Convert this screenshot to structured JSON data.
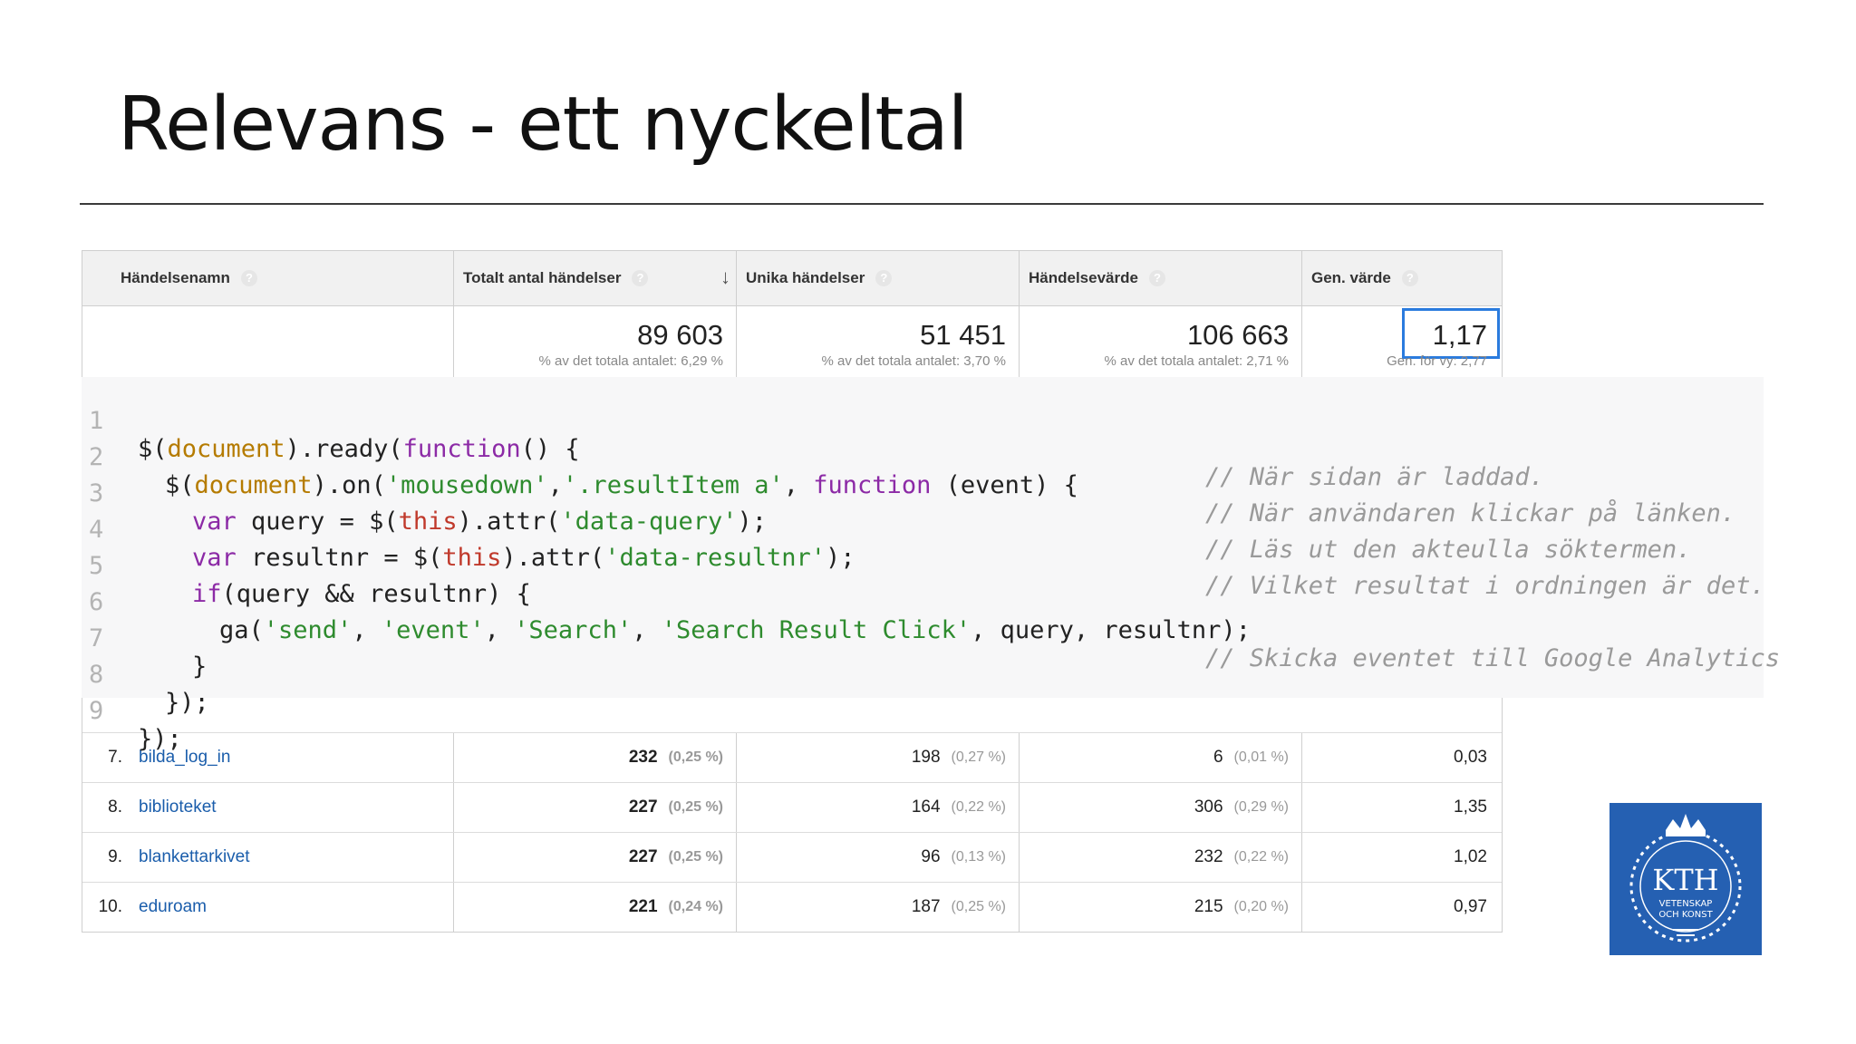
{
  "slide": {
    "title": "Relevans - ett nyckeltal"
  },
  "table": {
    "headers": [
      "Händelsenamn",
      "Totalt antal händelser",
      "Unika händelser",
      "Händelsevärde",
      "Gen. värde"
    ],
    "summary": [
      {
        "value": "89 603",
        "sub": "% av det totala antalet: 6,29 %"
      },
      {
        "value": "51 451",
        "sub": "% av det totala antalet: 3,70 %"
      },
      {
        "value": "106 663",
        "sub": "% av det totala antalet: 2,71 %"
      },
      {
        "value": "1,17",
        "sub": "Gen. för vy: 2,77"
      }
    ],
    "rows": [
      {
        "num": "7.",
        "name": "bilda_log_in",
        "total": "232",
        "total_pct": "(0,25 %)",
        "unique": "198",
        "unique_pct": "(0,27 %)",
        "value": "6",
        "value_pct": "(0,01 %)",
        "avg": "0,03"
      },
      {
        "num": "8.",
        "name": "biblioteket",
        "total": "227",
        "total_pct": "(0,25 %)",
        "unique": "164",
        "unique_pct": "(0,22 %)",
        "value": "306",
        "value_pct": "(0,29 %)",
        "avg": "1,35"
      },
      {
        "num": "9.",
        "name": "blankettarkivet",
        "total": "227",
        "total_pct": "(0,25 %)",
        "unique": "96",
        "unique_pct": "(0,13 %)",
        "value": "232",
        "value_pct": "(0,22 %)",
        "avg": "1,02"
      },
      {
        "num": "10.",
        "name": "eduroam",
        "total": "221",
        "total_pct": "(0,24 %)",
        "unique": "187",
        "unique_pct": "(0,25 %)",
        "value": "215",
        "value_pct": "(0,20 %)",
        "avg": "0,97"
      }
    ]
  },
  "code": {
    "line_numbers": [
      "1",
      "2",
      "3",
      "4",
      "5",
      "6",
      "7",
      "8",
      "9"
    ],
    "comments": [
      "// När sidan är laddad.",
      "// När användaren klickar på länken.",
      "// Läs ut den akteulla söktermen.",
      "// Vilket resultat i ordningen är det.",
      "",
      "// Skicka eventet till Google Analytics",
      "",
      "",
      ""
    ],
    "tokens": {
      "l1": [
        "$(",
        "document",
        ").ready(",
        "function",
        "() {"
      ],
      "l2": [
        "$(",
        "document",
        ").on(",
        "'mousedown'",
        ",",
        "'.resultItem a'",
        ", ",
        "function",
        " (event) {"
      ],
      "l3": [
        "var",
        " query = $(",
        "this",
        ").attr(",
        "'data-query'",
        ");"
      ],
      "l4": [
        "var",
        " resultnr = $(",
        "this",
        ").attr(",
        "'data-resultnr'",
        ");"
      ],
      "l5": [
        "if",
        "(query && resultnr) {"
      ],
      "l6": [
        "ga(",
        "'send'",
        ", ",
        "'event'",
        ", ",
        "'Search'",
        ", ",
        "'Search Result Click'",
        ", query, resultnr);"
      ],
      "l7": [
        "}"
      ],
      "l8": [
        "});"
      ],
      "l9": [
        "});"
      ]
    }
  },
  "logo": {
    "text": "KTH",
    "subtitle_line1": "VETENSKAP",
    "subtitle_line2": "OCH KONST",
    "color": "#2560b2"
  }
}
